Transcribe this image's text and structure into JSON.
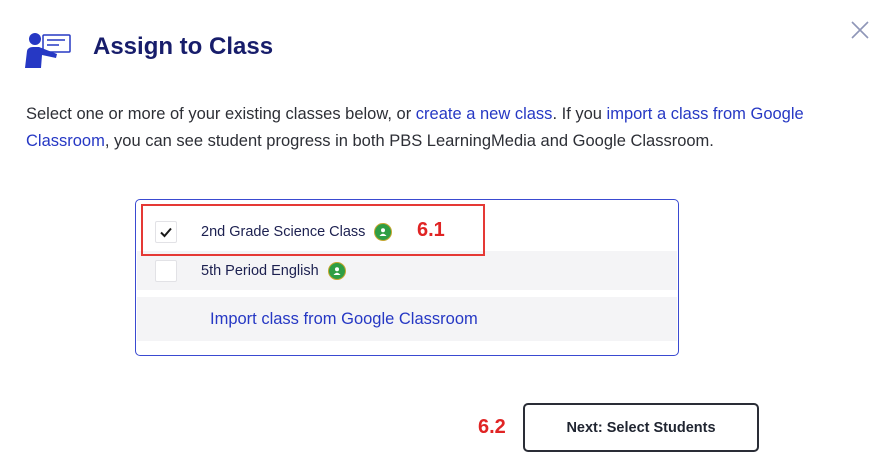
{
  "dialog": {
    "title": "Assign to Class",
    "close_icon": "close-icon",
    "title_icon": "teacher-presenting-icon"
  },
  "intro": {
    "text_1": "Select one or more of your existing classes below, or ",
    "link_create": "create a new class",
    "text_2": ". If you ",
    "link_import": "import a class from Google Classroom",
    "text_3": ", you can see student progress in both PBS LearningMedia and Google Classroom."
  },
  "classes": [
    {
      "name": "2nd Grade Science Class",
      "checked": true,
      "badge": "google-classroom-icon"
    },
    {
      "name": "5th Period English",
      "checked": false,
      "badge": "google-classroom-icon"
    }
  ],
  "import_link": "Import class from Google Classroom",
  "annotations": {
    "a1": "6.1",
    "a2": "6.2"
  },
  "next_button": "Next: Select Students",
  "colors": {
    "brand_navy": "#171d6b",
    "link_blue": "#2638c4",
    "annotation_red": "#e02424",
    "google_badge_green": "#2f9e44"
  }
}
